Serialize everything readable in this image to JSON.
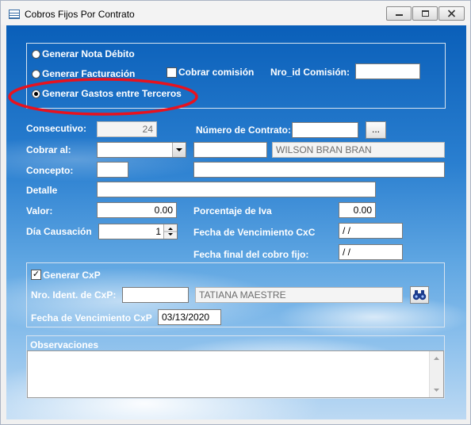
{
  "window": {
    "title": "Cobros Fijos Por Contrato"
  },
  "options": {
    "nota_debito": "Generar Nota Débito",
    "facturacion": "Generar Facturación",
    "cobrar_comision": "Cobrar comisión",
    "nro_id_comision": "Nro_id Comisión:",
    "gastos_terceros": "Generar Gastos entre Terceros",
    "selected": "gastos_terceros"
  },
  "form": {
    "consecutivo_label": "Consecutivo:",
    "consecutivo_value": "24",
    "contrato_label": "Número de Contrato:",
    "browse_label": "...",
    "cobrar_label": "Cobrar al:",
    "cobrar_name": "WILSON BRAN BRAN",
    "concepto_label": "Concepto:",
    "detalle_label": "Detalle",
    "valor_label": "Valor:",
    "valor_value": "0.00",
    "iva_label": "Porcentaje de Iva",
    "iva_value": "0.00",
    "dia_label": "Día Causación",
    "dia_value": "1",
    "venc_label": "Fecha de Vencimiento CxC",
    "venc_value": " / /",
    "final_label": "Fecha final del cobro fijo:",
    "final_value": " / /"
  },
  "cxp": {
    "generar_label": "Generar CxP",
    "nro_label": "Nro. Ident. de CxP:",
    "name_value": "TATIANA MAESTRE",
    "venc_label": "Fecha de Vencimiento CxP",
    "venc_value": "03/13/2020"
  },
  "obs": {
    "label": "Observaciones"
  },
  "colors": {
    "highlight": "#e8121e",
    "panel_border": "#d8e4f0"
  }
}
